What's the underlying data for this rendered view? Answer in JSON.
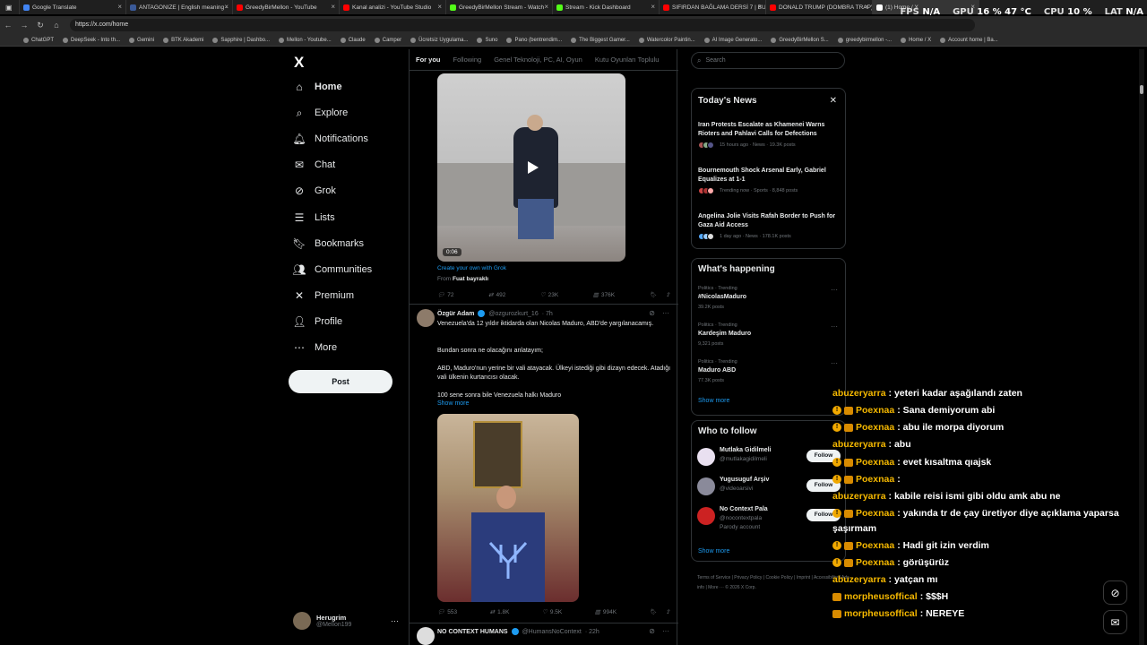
{
  "browser": {
    "tabs": [
      {
        "title": "Google Translate",
        "color": "#4285f4"
      },
      {
        "title": "ANTAGONIZE | English meaning -",
        "color": "#3a5a99"
      },
      {
        "title": "GreedyBirMellon - YouTube",
        "color": "#ff0000"
      },
      {
        "title": "Kanal analizi - YouTube Studio",
        "color": "#ff0000"
      },
      {
        "title": "GreedyBirMellon Stream - Watch",
        "color": "#53fc18"
      },
      {
        "title": "Stream - Kick Dashboard",
        "color": "#53fc18"
      },
      {
        "title": "SIFIRDAN BAĞLAMA DERSİ 7 | BU",
        "color": "#ff0000"
      },
      {
        "title": "DONALD TRUMP (DOMBRA TRAP)",
        "color": "#ff0000"
      },
      {
        "title": "(1) Home / X",
        "color": "#ffffff"
      }
    ],
    "hud": {
      "fps_label": "FPS",
      "fps_value": "N/A",
      "gpu_label": "GPU",
      "gpu_value": "16 % 47 °C",
      "cpu_label": "CPU",
      "cpu_value": "10 %",
      "lat_label": "LAT",
      "lat_value": "N/A"
    },
    "url": "https://x.com/home",
    "bookmarks": [
      "ChatGPT",
      "DeepSeek - Into th...",
      "Gemini",
      "BTK Akademi",
      "Sapphire | Dashbo...",
      "Mellon - Youtube...",
      "Claude",
      "Camper",
      "Ücretsiz Uygulama...",
      "Suno",
      "Pano (bentrendim...",
      "The Biggest Gamer...",
      "Watercolor Paintin...",
      "AI Image Generato...",
      "GreedyBirMellon S...",
      "greedybirmellon -...",
      "Home / X",
      "Account home | Ba..."
    ]
  },
  "nav": {
    "logo": "X",
    "items": [
      {
        "label": "Home",
        "icon": "home-icon"
      },
      {
        "label": "Explore",
        "icon": "search-icon"
      },
      {
        "label": "Notifications",
        "icon": "bell-icon"
      },
      {
        "label": "Chat",
        "icon": "mail-icon"
      },
      {
        "label": "Grok",
        "icon": "grok-icon"
      },
      {
        "label": "Lists",
        "icon": "list-icon"
      },
      {
        "label": "Bookmarks",
        "icon": "bookmark-icon"
      },
      {
        "label": "Communities",
        "icon": "people-icon"
      },
      {
        "label": "Premium",
        "icon": "x-icon"
      },
      {
        "label": "Profile",
        "icon": "person-icon"
      },
      {
        "label": "More",
        "icon": "more-icon"
      }
    ],
    "post_label": "Post",
    "account": {
      "name": "Herugrim",
      "handle": "@Mellon199"
    }
  },
  "timeline": {
    "tabs": [
      "For you",
      "Following",
      "Genel Teknoloji, PC, AI, Oyun",
      "Kutu Oyunları Toplulu"
    ],
    "tweet1": {
      "duration": "0:06",
      "grok_link": "Create your own with Grok",
      "from_label": "From",
      "from_name": "Fuat bayraklı",
      "replies": "72",
      "reposts": "492",
      "likes": "23K",
      "views": "376K"
    },
    "tweet2": {
      "name": "Özgür Adam",
      "handle": "@ozgurozkurt_16",
      "time": "· 7h",
      "text1": "Venezuela'da 12 yıldır iktidarda olan Nicolas Maduro, ABD'de yargılanacamış.",
      "text2": "Bundan sonra ne olacağını anlatayım;",
      "text3": "ABD, Maduro'nun yerine bir vali atayacak. Ülkeyi istediği gibi dizayn edecek. Atadığı vali ülkenin kurtarıcısı olacak.",
      "text4": "100 sene sonra bile Venezuela halkı Maduro",
      "show_more": "Show more",
      "replies": "553",
      "reposts": "1.8K",
      "likes": "9.5K",
      "views": "994K"
    },
    "tweet3": {
      "name": "NO CONTEXT HUMANS",
      "handle": "@HumansNoContext",
      "time": "· 22h"
    }
  },
  "right": {
    "search_placeholder": "Search",
    "news": {
      "title": "Today's News",
      "items": [
        {
          "title": "Iran Protests Escalate as Khamenei Warns Rioters and Pahlavi Calls for Defections",
          "meta": "15 hours ago · News · 19.3K posts"
        },
        {
          "title": "Bournemouth Shock Arsenal Early, Gabriel Equalizes at 1-1",
          "meta": "Trending now · Sports · 8,848 posts"
        },
        {
          "title": "Angelina Jolie Visits Rafah Border to Push for Gaza Aid Access",
          "meta": "1 day ago · News · 178.1K posts"
        }
      ]
    },
    "happening": {
      "title": "What's happening",
      "items": [
        {
          "cat": "Politics · Trending",
          "name": "#NicolasMaduro",
          "posts": "39.2K posts"
        },
        {
          "cat": "Politics · Trending",
          "name": "Kardeşim Maduro",
          "posts": "9,321 posts"
        },
        {
          "cat": "Politics · Trending",
          "name": "Maduro ABD",
          "posts": "77.3K posts"
        }
      ],
      "show_more": "Show more"
    },
    "follow": {
      "title": "Who to follow",
      "items": [
        {
          "name": "Mutlaka Gidilmeli",
          "handle": "@mutlakagidilmeli",
          "extra": ""
        },
        {
          "name": "Yugusuguf Arşiv",
          "handle": "@videoarsivi",
          "extra": ""
        },
        {
          "name": "No Context Pala",
          "handle": "@nocontextpala",
          "extra": "Parody account"
        }
      ],
      "follow_label": "Follow",
      "show_more": "Show more"
    },
    "footer": "Terms of Service | Privacy Policy | Cookie Policy | Imprint | Accessibility | Ads info | More ··· © 2026 X Corp."
  },
  "chat": [
    {
      "user": "abuzeryarra",
      "msg": " : yeteri kadar aşağılandı zaten",
      "badges": 0,
      "color": "#f5b800"
    },
    {
      "user": "Poexnaa",
      "msg": " : Sana demiyorum abi",
      "badges": 2,
      "color": "#f5b800"
    },
    {
      "user": "Poexnaa",
      "msg": " : abu ile morpa diyorum",
      "badges": 2,
      "color": "#f5b800"
    },
    {
      "user": "abuzeryarra",
      "msg": " : abu",
      "badges": 0,
      "color": "#f5b800"
    },
    {
      "user": "Poexnaa",
      "msg": " : evet kısaltma qıajsk",
      "badges": 2,
      "color": "#f5b800"
    },
    {
      "user": "Poexnaa",
      "msg": " : ",
      "badges": 2,
      "color": "#f5b800"
    },
    {
      "user": "abuzeryarra",
      "msg": " : kabile reisi ismi gibi oldu amk abu ne",
      "badges": 0,
      "color": "#f5b800"
    },
    {
      "user": "Poexnaa",
      "msg": " : yakında tr de çay üretiyor diye açıklama yaparsa",
      "badges": 2,
      "color": "#f5b800"
    },
    {
      "user": "",
      "msg": "şaşırmam",
      "badges": 0,
      "color": "#f5b800"
    },
    {
      "user": "Poexnaa",
      "msg": " : Hadi git izin verdim",
      "badges": 2,
      "color": "#f5b800"
    },
    {
      "user": "Poexnaa",
      "msg": " : görüşürüz",
      "badges": 2,
      "color": "#f5b800"
    },
    {
      "user": "abuzeryarra",
      "msg": " : yatçan mı",
      "badges": 0,
      "color": "#f5b800"
    },
    {
      "user": "morpheusoffical",
      "msg": " : $$$H",
      "badges": 1,
      "color": "#f5b800"
    },
    {
      "user": "morpheusoffical",
      "msg": " : NEREYE",
      "badges": 1,
      "color": "#f5b800"
    }
  ]
}
